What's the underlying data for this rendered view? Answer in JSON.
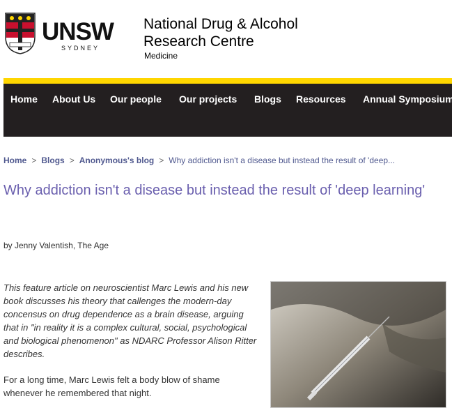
{
  "brand": {
    "logo_text": "UNSW",
    "logo_sub": "SYDNEY",
    "site_title_line1": "National Drug & Alcohol",
    "site_title_line2": "Research Centre",
    "site_subtitle": "Medicine"
  },
  "nav": {
    "items": [
      "Home",
      "About Us",
      "Our people",
      "Our projects",
      "Blogs",
      "Resources",
      "Annual Symposium"
    ]
  },
  "breadcrumb": {
    "home": "Home",
    "blogs": "Blogs",
    "author_blog": "Anonymous's blog",
    "current": "Why addiction isn't a disease but instead the result of 'deep..."
  },
  "article": {
    "title": "Why addiction isn't a disease but instead the result of 'deep learning'",
    "byline": "by Jenny Valentish, The Age",
    "lead": "This feature article on neuroscientist Marc Lewis and his new book discusses his theory that callenges the modern-day concensus on drug dependence as a brain disease, arguing that in \"in reality it is a complex cultural, social, psychological and biological phenomenon\" as NDARC Professor Alison Ritter describes.",
    "para1": "For a long time, Marc Lewis felt a body blow of shame whenever he remembered that night."
  },
  "colors": {
    "nav_bg": "#231f20",
    "accent_yellow": "#ffd600",
    "title_purple": "#6a5fae",
    "link": "#50598f"
  }
}
